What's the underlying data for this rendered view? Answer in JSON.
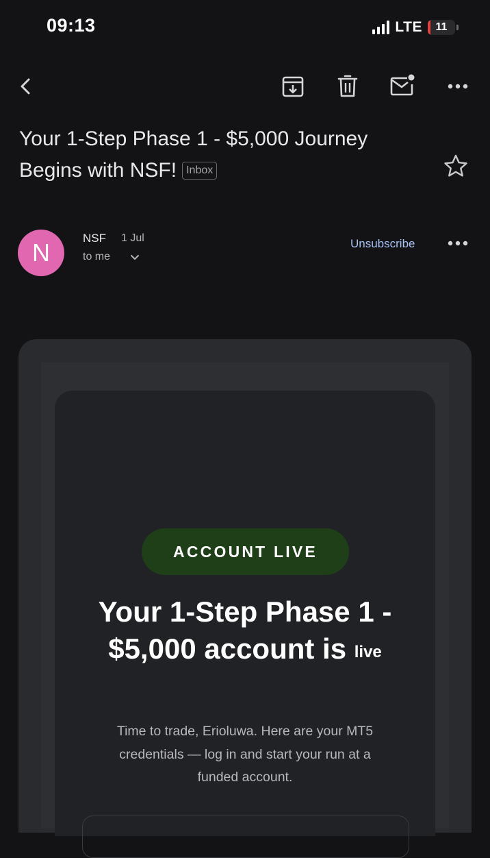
{
  "status_bar": {
    "time": "09:13",
    "network": "LTE",
    "battery_level": "11",
    "battery_fraction": 0.11
  },
  "toolbar": {
    "icons": [
      "back-arrow-icon",
      "archive-icon",
      "trash-icon",
      "mark-unread-icon",
      "more-vert-icon"
    ]
  },
  "email": {
    "subject": "Your 1-Step Phase 1 - $5,000 Journey Begins with NSF!",
    "label": "Inbox",
    "sender": {
      "initial": "N",
      "name": "NSF",
      "date": "1 Jul",
      "to": "to me",
      "avatar_color": "#e267b1"
    },
    "unsubscribe_label": "Unsubscribe"
  },
  "body": {
    "badge": "ACCOUNT LIVE",
    "headline_main": "Your 1-Step Phase 1 - $5,000 account is",
    "headline_tail": "live",
    "message": "Time to trade, Erioluwa. Here are your MT5 credentials — log in and start your run at a funded account."
  },
  "colors": {
    "background": "#131315",
    "badge_green": "#1f3f19",
    "link_blue": "#a8c2f5"
  }
}
